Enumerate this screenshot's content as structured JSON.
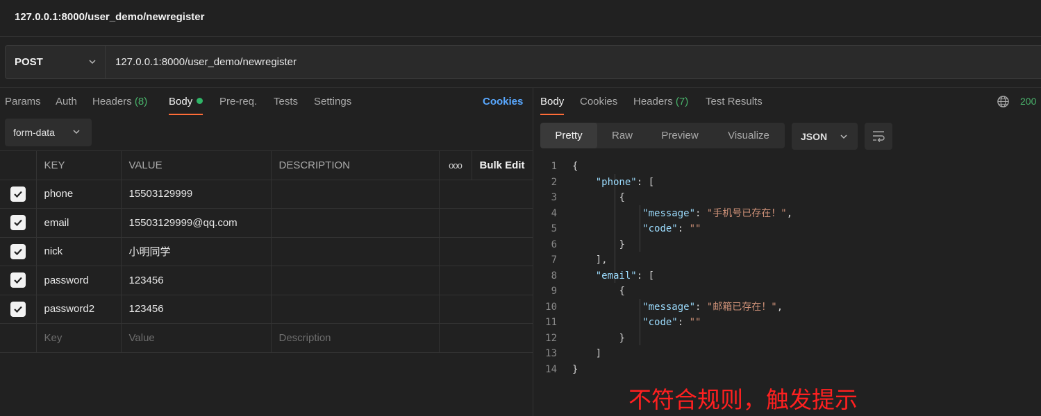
{
  "window": {
    "title": "127.0.0.1:8000/user_demo/newregister"
  },
  "request": {
    "method": "POST",
    "url": "127.0.0.1:8000/user_demo/newregister",
    "tabs": {
      "params": "Params",
      "auth": "Auth",
      "headers": "Headers",
      "headers_count": "(8)",
      "body": "Body",
      "prereq": "Pre-req.",
      "tests": "Tests",
      "settings": "Settings"
    },
    "cookies_link": "Cookies",
    "body_type": "form-data",
    "table": {
      "headers": {
        "key": "KEY",
        "value": "VALUE",
        "description": "DESCRIPTION",
        "more": "ooo",
        "bulk_edit": "Bulk Edit"
      },
      "rows": [
        {
          "key": "phone",
          "value": "15503129999",
          "checked": true
        },
        {
          "key": "email",
          "value": "15503129999@qq.com",
          "checked": true
        },
        {
          "key": "nick",
          "value": "小明同学",
          "checked": true
        },
        {
          "key": "password",
          "value": "123456",
          "checked": true
        },
        {
          "key": "password2",
          "value": "123456",
          "checked": true
        }
      ],
      "placeholders": {
        "key": "Key",
        "value": "Value",
        "description": "Description"
      }
    }
  },
  "response": {
    "tabs": {
      "body": "Body",
      "cookies": "Cookies",
      "headers": "Headers",
      "headers_count": "(7)",
      "test_results": "Test Results"
    },
    "status_code": "200",
    "views": {
      "pretty": "Pretty",
      "raw": "Raw",
      "preview": "Preview",
      "visualize": "Visualize"
    },
    "format": "JSON",
    "code": {
      "line_numbers": [
        "1",
        "2",
        "3",
        "4",
        "5",
        "6",
        "7",
        "8",
        "9",
        "10",
        "11",
        "12",
        "13",
        "14"
      ],
      "open_brace": "{",
      "close_brace": "}",
      "phone_key": "\"phone\"",
      "email_key": "\"email\"",
      "message_key": "\"message\"",
      "code_key": "\"code\"",
      "phone_message": "\"手机号已存在！\"",
      "email_message": "\"邮箱已存在！\"",
      "empty_string": "\"\""
    }
  },
  "annotation": "不符合规则，触发提示",
  "colors": {
    "accent": "#ff6c37",
    "link": "#59a8ff",
    "success": "#49b36b",
    "annotation": "#ff2020"
  }
}
